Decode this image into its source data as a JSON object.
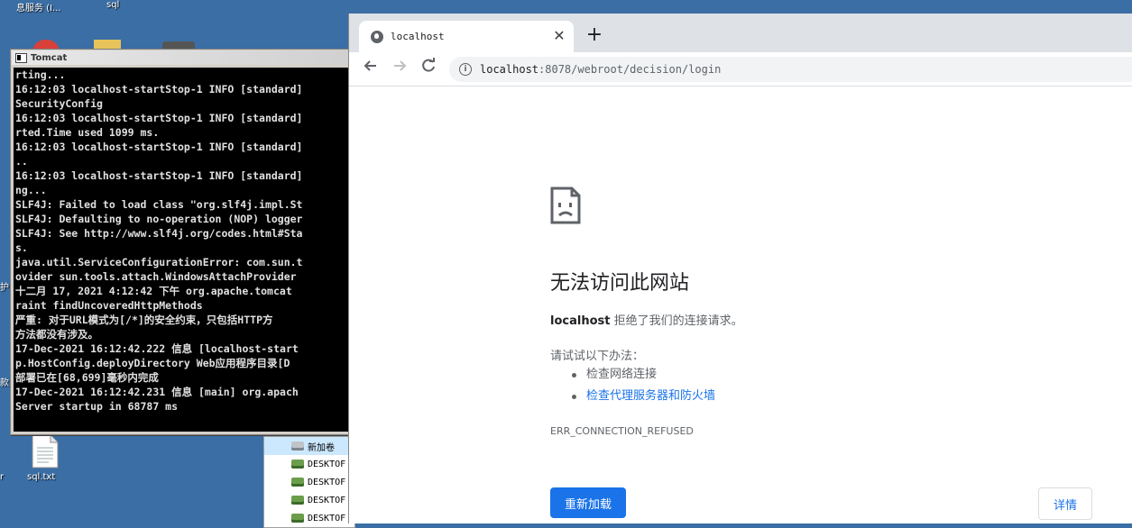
{
  "desktop": {
    "labels": {
      "top_left": "息服务 (I...",
      "top_second": "sql",
      "side_hu": "护",
      "side_kuan": "款",
      "side_r": "r",
      "file": "sql.txt"
    }
  },
  "explorer": {
    "items": [
      "新加卷",
      "DESKTOF",
      "DESKTOF",
      "DESKTOF",
      "DESKTOF"
    ]
  },
  "tomcat": {
    "title": "Tomcat",
    "lines": [
      "rting...",
      "16:12:03 localhost-startStop-1 INFO [standard]",
      "SecurityConfig",
      "16:12:03 localhost-startStop-1 INFO [standard]",
      "rted.Time used 1099 ms.",
      "16:12:03 localhost-startStop-1 INFO [standard]",
      "..",
      "16:12:03 localhost-startStop-1 INFO [standard]",
      "ng...",
      "SLF4J: Failed to load class \"org.slf4j.impl.St",
      "SLF4J: Defaulting to no-operation (NOP) logger",
      "SLF4J: See http://www.slf4j.org/codes.html#Sta",
      "s.",
      "java.util.ServiceConfigurationError: com.sun.t",
      "ovider sun.tools.attach.WindowsAttachProvider",
      "十二月 17, 2021 4:12:42 下午 org.apache.tomcat",
      "raint findUncoveredHttpMethods",
      "严重: 对于URL模式为[/*]的安全约束，只包括HTTP方",
      "方法都没有涉及。",
      "17-Dec-2021 16:12:42.222 信息 [localhost-start",
      "p.HostConfig.deployDirectory Web应用程序目录[D",
      "部署已在[68,699]毫秒内完成",
      "17-Dec-2021 16:12:42.231 信息 [main] org.apach",
      "Server startup in 68787 ms"
    ]
  },
  "browser": {
    "tab_title": "localhost",
    "url_host": "localhost",
    "url_path": ":8078/webroot/decision/login",
    "error": {
      "title": "无法访问此网站",
      "host": "localhost",
      "desc": " 拒绝了我们的连接请求。",
      "try_heading": "请试试以下办法：",
      "suggestions": [
        "检查网络连接",
        "检查代理服务器和防火墙"
      ],
      "code": "ERR_CONNECTION_REFUSED",
      "reload_label": "重新加载",
      "details_label": "详情"
    }
  },
  "colors": {
    "desktop_bg": "#3a6ea5",
    "accent_blue": "#1a73e8",
    "console_bg": "#000000"
  }
}
